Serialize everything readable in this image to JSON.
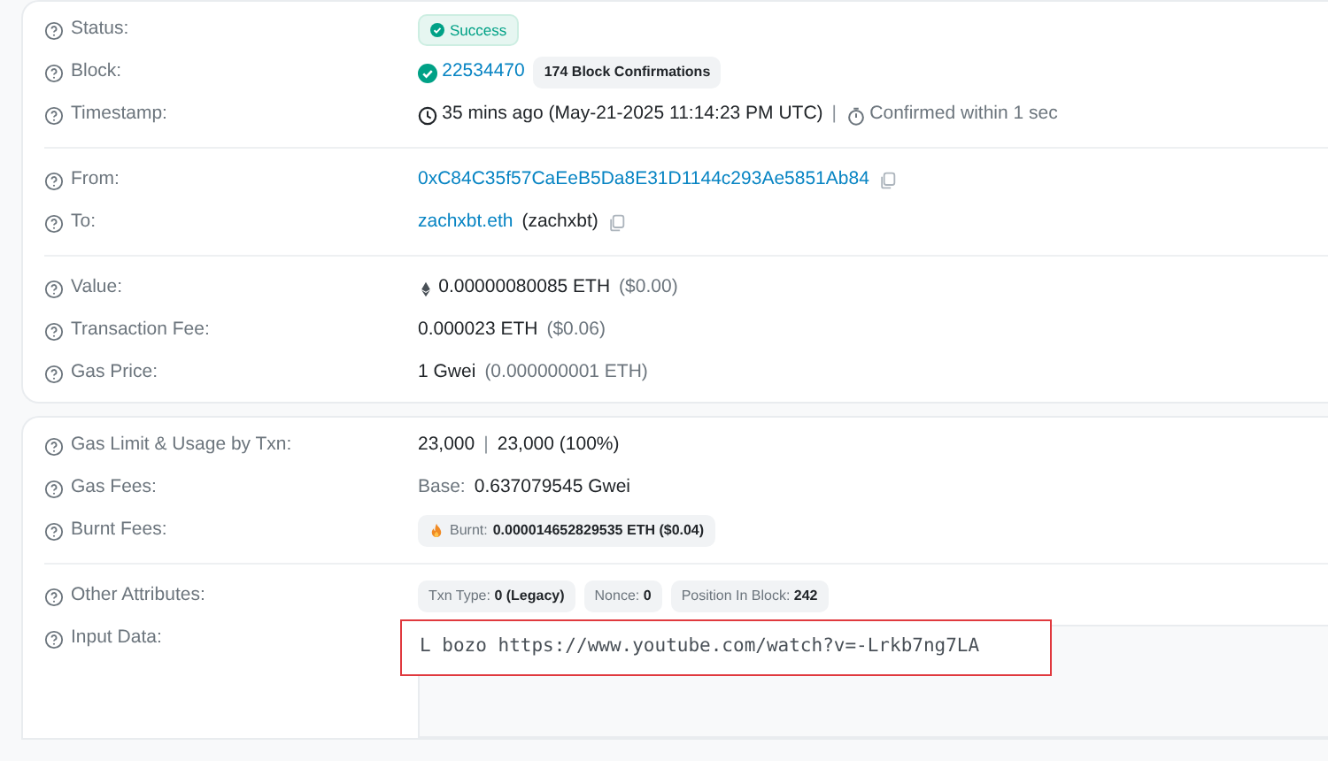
{
  "cards": [
    {
      "sections": [
        {
          "rows": [
            {
              "label": "Status:",
              "value": [
                {
                  "kind": "status",
                  "text": "Success"
                }
              ]
            },
            {
              "label": "Block:",
              "value": [
                {
                  "kind": "check_link",
                  "text": "22534470"
                },
                {
                  "kind": "pill",
                  "text": "174 Block Confirmations"
                }
              ]
            },
            {
              "label": "Timestamp:",
              "value": [
                {
                  "kind": "clock",
                  "text": "35 mins ago (May-21-2025 11:14:23 PM UTC)"
                },
                {
                  "kind": "sep",
                  "text": "|"
                },
                {
                  "kind": "timer",
                  "text": "Confirmed within 1 sec"
                }
              ]
            }
          ]
        },
        {
          "rows": [
            {
              "label": "From:",
              "value": [
                {
                  "kind": "link",
                  "text": "0xC84C35f57CaEeB5Da8E31D1144c293Ae5851Ab84"
                },
                {
                  "kind": "copy"
                }
              ]
            },
            {
              "label": "To:",
              "value": [
                {
                  "kind": "link",
                  "text": "zachxbt.eth"
                },
                {
                  "kind": "text",
                  "text": "(zachxbt)"
                },
                {
                  "kind": "copy"
                }
              ]
            }
          ]
        },
        {
          "rows": [
            {
              "label": "Value:",
              "value": [
                {
                  "kind": "eth",
                  "text": "0.00000080085 ETH"
                },
                {
                  "kind": "muted",
                  "text": "($0.00)"
                }
              ]
            },
            {
              "label": "Transaction Fee:",
              "value": [
                {
                  "kind": "text",
                  "text": "0.000023 ETH"
                },
                {
                  "kind": "muted",
                  "text": "($0.06)"
                }
              ]
            },
            {
              "label": "Gas Price:",
              "value": [
                {
                  "kind": "text",
                  "text": "1 Gwei"
                },
                {
                  "kind": "muted",
                  "text": "(0.000000001 ETH)"
                }
              ]
            }
          ]
        }
      ]
    },
    {
      "sections": [
        {
          "rows": [
            {
              "label": "Gas Limit & Usage by Txn:",
              "value": [
                {
                  "kind": "text",
                  "text": "23,000"
                },
                {
                  "kind": "sep",
                  "text": "|"
                },
                {
                  "kind": "text",
                  "text": "23,000 (100%)"
                }
              ]
            },
            {
              "label": "Gas Fees:",
              "value": [
                {
                  "kind": "muted",
                  "text": "Base:"
                },
                {
                  "kind": "text",
                  "text": "0.637079545 Gwei"
                }
              ]
            },
            {
              "label": "Burnt Fees:",
              "value": [
                {
                  "kind": "burnt",
                  "label": "Burnt:",
                  "text": "0.000014652829535 ETH ($0.04)"
                }
              ]
            }
          ]
        },
        {
          "rows": [
            {
              "label": "Other Attributes:",
              "value": [
                {
                  "kind": "attr",
                  "label": "Txn Type:",
                  "text": "0 (Legacy)"
                },
                {
                  "kind": "attr",
                  "label": "Nonce:",
                  "text": "0"
                },
                {
                  "kind": "attr",
                  "label": "Position In Block:",
                  "text": "242"
                }
              ]
            },
            {
              "label": "Input Data:",
              "value": [
                {
                  "kind": "input",
                  "text": "L bozo https://www.youtube.com/watch?v=-Lrkb7ng7LA",
                  "highlighted": true
                }
              ]
            }
          ]
        }
      ]
    }
  ]
}
